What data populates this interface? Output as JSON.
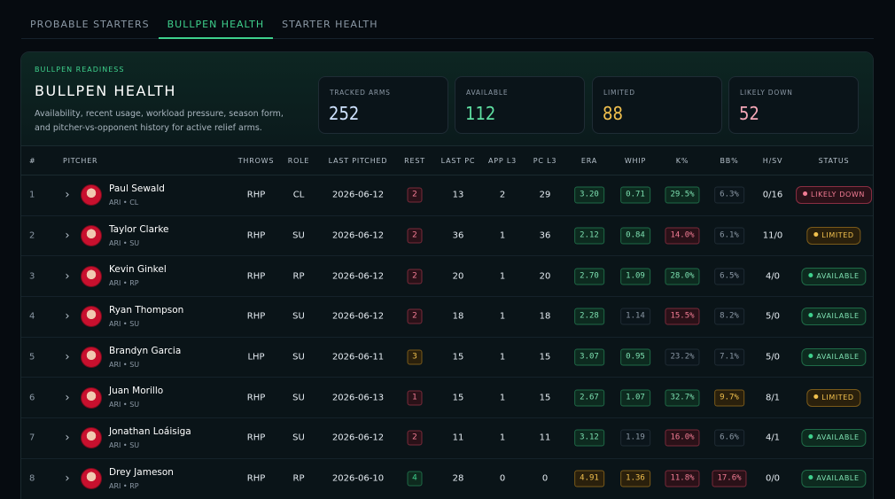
{
  "tabs": [
    {
      "label": "PROBABLE STARTERS",
      "active": false
    },
    {
      "label": "BULLPEN HEALTH",
      "active": true
    },
    {
      "label": "STARTER HEALTH",
      "active": false
    }
  ],
  "hero": {
    "eyebrow": "BULLPEN READINESS",
    "title": "BULLPEN HEALTH",
    "description": "Availability, recent usage, workload pressure, season form, and pitcher-vs-opponent history for active relief arms."
  },
  "stats": [
    {
      "label": "TRACKED ARMS",
      "value": "252",
      "color": "#cfe3ff"
    },
    {
      "label": "AVAILABLE",
      "value": "112",
      "color": "#5fe0a2"
    },
    {
      "label": "LIMITED",
      "value": "88",
      "color": "#f2c14e"
    },
    {
      "label": "LIKELY DOWN",
      "value": "52",
      "color": "#f7a8b8"
    }
  ],
  "columns": [
    "#",
    "PITCHER",
    "THROWS",
    "ROLE",
    "LAST PITCHED",
    "REST",
    "LAST PC",
    "APP L3",
    "PC L3",
    "ERA",
    "WHIP",
    "K%",
    "BB%",
    "H/SV",
    "STATUS"
  ],
  "rows": [
    {
      "num": "1",
      "name": "Paul Sewald",
      "team": "ARI • CL",
      "throws": "RHP",
      "role": "CL",
      "last": "2026-06-12",
      "rest": "2",
      "restc": "red",
      "lastpc": "13",
      "app": "2",
      "pc": "29",
      "era": "3.20",
      "erac": "g",
      "whip": "0.71",
      "whipc": "g",
      "k": "29.5%",
      "kc": "g",
      "bb": "6.3%",
      "bbc": "n",
      "hsv": "0/16",
      "status": "LIKELY DOWN",
      "statusc": "down"
    },
    {
      "num": "2",
      "name": "Taylor Clarke",
      "team": "ARI • SU",
      "throws": "RHP",
      "role": "SU",
      "last": "2026-06-12",
      "rest": "2",
      "restc": "red",
      "lastpc": "36",
      "app": "1",
      "pc": "36",
      "era": "2.12",
      "erac": "g",
      "whip": "0.84",
      "whipc": "g",
      "k": "14.0%",
      "kc": "r",
      "bb": "6.1%",
      "bbc": "n",
      "hsv": "11/0",
      "status": "LIMITED",
      "statusc": "lim"
    },
    {
      "num": "3",
      "name": "Kevin Ginkel",
      "team": "ARI • RP",
      "throws": "RHP",
      "role": "RP",
      "last": "2026-06-12",
      "rest": "2",
      "restc": "red",
      "lastpc": "20",
      "app": "1",
      "pc": "20",
      "era": "2.70",
      "erac": "g",
      "whip": "1.09",
      "whipc": "g",
      "k": "28.0%",
      "kc": "g",
      "bb": "6.5%",
      "bbc": "n",
      "hsv": "4/0",
      "status": "AVAILABLE",
      "statusc": "avail"
    },
    {
      "num": "4",
      "name": "Ryan Thompson",
      "team": "ARI • SU",
      "throws": "RHP",
      "role": "SU",
      "last": "2026-06-12",
      "rest": "2",
      "restc": "red",
      "lastpc": "18",
      "app": "1",
      "pc": "18",
      "era": "2.28",
      "erac": "g",
      "whip": "1.14",
      "whipc": "n",
      "k": "15.5%",
      "kc": "r",
      "bb": "8.2%",
      "bbc": "n",
      "hsv": "5/0",
      "status": "AVAILABLE",
      "statusc": "avail"
    },
    {
      "num": "5",
      "name": "Brandyn Garcia",
      "team": "ARI • SU",
      "throws": "LHP",
      "role": "SU",
      "last": "2026-06-11",
      "rest": "3",
      "restc": "amber",
      "lastpc": "15",
      "app": "1",
      "pc": "15",
      "era": "3.07",
      "erac": "g",
      "whip": "0.95",
      "whipc": "g",
      "k": "23.2%",
      "kc": "n",
      "bb": "7.1%",
      "bbc": "n",
      "hsv": "5/0",
      "status": "AVAILABLE",
      "statusc": "avail"
    },
    {
      "num": "6",
      "name": "Juan Morillo",
      "team": "ARI • SU",
      "throws": "RHP",
      "role": "SU",
      "last": "2026-06-13",
      "rest": "1",
      "restc": "red",
      "lastpc": "15",
      "app": "1",
      "pc": "15",
      "era": "2.67",
      "erac": "g",
      "whip": "1.07",
      "whipc": "g",
      "k": "32.7%",
      "kc": "g",
      "bb": "9.7%",
      "bbc": "a",
      "hsv": "8/1",
      "status": "LIMITED",
      "statusc": "lim"
    },
    {
      "num": "7",
      "name": "Jonathan Loáisiga",
      "team": "ARI • SU",
      "throws": "RHP",
      "role": "SU",
      "last": "2026-06-12",
      "rest": "2",
      "restc": "red",
      "lastpc": "11",
      "app": "1",
      "pc": "11",
      "era": "3.12",
      "erac": "g",
      "whip": "1.19",
      "whipc": "n",
      "k": "16.0%",
      "kc": "r",
      "bb": "6.6%",
      "bbc": "n",
      "hsv": "4/1",
      "status": "AVAILABLE",
      "statusc": "avail"
    },
    {
      "num": "8",
      "name": "Drey Jameson",
      "team": "ARI • RP",
      "throws": "RHP",
      "role": "RP",
      "last": "2026-06-10",
      "rest": "4",
      "restc": "green",
      "lastpc": "28",
      "app": "0",
      "pc": "0",
      "era": "4.91",
      "erac": "a",
      "whip": "1.36",
      "whipc": "a",
      "k": "11.8%",
      "kc": "r",
      "bb": "17.6%",
      "bbc": "r",
      "hsv": "0/0",
      "status": "AVAILABLE",
      "statusc": "avail"
    }
  ]
}
